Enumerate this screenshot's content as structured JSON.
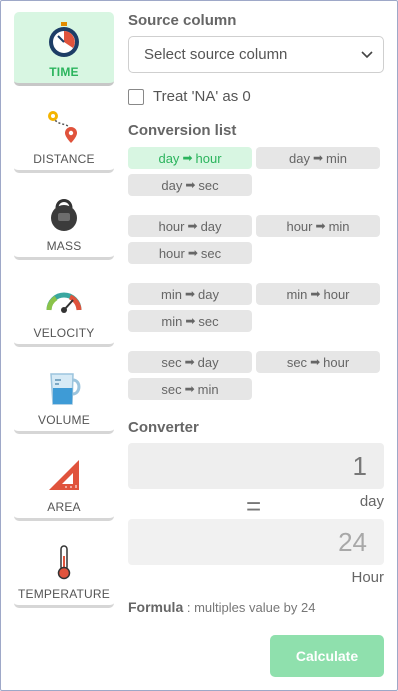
{
  "sidebar": {
    "items": [
      {
        "label": "TIME",
        "icon": "stopwatch-icon",
        "active": true
      },
      {
        "label": "DISTANCE",
        "icon": "route-pin-icon",
        "active": false
      },
      {
        "label": "MASS",
        "icon": "kettlebell-icon",
        "active": false
      },
      {
        "label": "VELOCITY",
        "icon": "speedometer-icon",
        "active": false
      },
      {
        "label": "VOLUME",
        "icon": "measuring-cup-icon",
        "active": false
      },
      {
        "label": "AREA",
        "icon": "set-square-icon",
        "active": false
      },
      {
        "label": "TEMPERATURE",
        "icon": "thermometer-icon",
        "active": false
      }
    ]
  },
  "source": {
    "title": "Source column",
    "placeholder": "Select source column",
    "treat_na_label": "Treat 'NA' as 0"
  },
  "conversions": {
    "title": "Conversion list",
    "arrow": "➡",
    "groups": [
      [
        {
          "from": "day",
          "to": "hour",
          "active": true
        },
        {
          "from": "day",
          "to": "min"
        },
        {
          "from": "day",
          "to": "sec"
        }
      ],
      [
        {
          "from": "hour",
          "to": "day"
        },
        {
          "from": "hour",
          "to": "min"
        },
        {
          "from": "hour",
          "to": "sec"
        }
      ],
      [
        {
          "from": "min",
          "to": "day"
        },
        {
          "from": "min",
          "to": "hour"
        },
        {
          "from": "min",
          "to": "sec"
        }
      ],
      [
        {
          "from": "sec",
          "to": "day"
        },
        {
          "from": "sec",
          "to": "hour"
        },
        {
          "from": "sec",
          "to": "min"
        }
      ]
    ]
  },
  "converter": {
    "title": "Converter",
    "input_value": "1",
    "input_unit": "day",
    "equals": "=",
    "output_value": "24",
    "output_unit": "Hour"
  },
  "formula": {
    "label": "Formula",
    "text": " : multiples value by 24"
  },
  "calculate_label": "Calculate",
  "colors": {
    "accent_green": "#2bb45d",
    "active_bg": "#d8f6e2",
    "button_bg": "#8fe0ad"
  }
}
